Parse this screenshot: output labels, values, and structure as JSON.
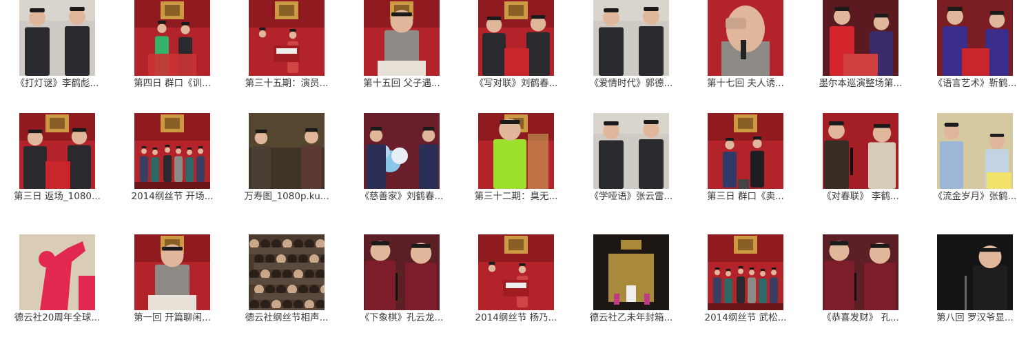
{
  "videos": [
    {
      "title": "《打灯谜》李鹤彪...",
      "thumb": "stage-duo-gray"
    },
    {
      "title": "第四日 群口《训...",
      "thumb": "stage-red-green"
    },
    {
      "title": "第三十五期：演员...",
      "thumb": "stage-wide-red"
    },
    {
      "title": "第十五回 父子遇...",
      "thumb": "solo-speaker-red"
    },
    {
      "title": "《写对联》刘鹤春...",
      "thumb": "stage-duo-red"
    },
    {
      "title": "《爱情时代》郭德...",
      "thumb": "stage-duo-gray"
    },
    {
      "title": "第十七回 夫人诱...",
      "thumb": "solo-face-close"
    },
    {
      "title": "墨尔本巡演整场第...",
      "thumb": "stage-duo-red-purple"
    },
    {
      "title": "《语言艺术》靳鹤...",
      "thumb": "stage-duo-purple"
    },
    {
      "title": "第三日 返场_1080...",
      "thumb": "stage-duo-red"
    },
    {
      "title": "2014纲丝节 开场...",
      "thumb": "stage-group-wide"
    },
    {
      "title": "万寿图_1080p.ku...",
      "thumb": "stage-dark-duo"
    },
    {
      "title": "《慈善家》刘鹤春...",
      "thumb": "stage-flowers"
    },
    {
      "title": "第三十二期：臭无...",
      "thumb": "solo-green"
    },
    {
      "title": "《学哑语》张云雷...",
      "thumb": "stage-duo-gray"
    },
    {
      "title": "第三日 群口《卖...",
      "thumb": "stage-duo-suits"
    },
    {
      "title": "《对春联》 李鹤...",
      "thumb": "stage-duo-beige"
    },
    {
      "title": "《流金岁月》张鹤...",
      "thumb": "stage-duo-blue"
    },
    {
      "title": "德云社20周年全球...",
      "thumb": "solo-red-dance"
    },
    {
      "title": "第一回 开篇聊闲...",
      "thumb": "solo-speaker-red"
    },
    {
      "title": "德云社纲丝节相声...",
      "thumb": "audience"
    },
    {
      "title": "《下象棋》孔云龙...",
      "thumb": "stage-duo-close"
    },
    {
      "title": "2014纲丝节 杨乃...",
      "thumb": "stage-wide-red"
    },
    {
      "title": "德云社乙未年封箱...",
      "thumb": "stage-dark-gold"
    },
    {
      "title": "2014纲丝节 武松...",
      "thumb": "stage-group-wide"
    },
    {
      "title": "《恭喜发财》 孔...",
      "thumb": "stage-duo-close"
    },
    {
      "title": "第八回 罗汉爷显...",
      "thumb": "solo-dark"
    }
  ],
  "colors": {
    "caption_text": "#3a3a3a",
    "stage_red": "#b3242a",
    "stage_gold": "#d8b24a",
    "robe_gray": "#8d8a86",
    "robe_dark": "#2a2a2e"
  }
}
